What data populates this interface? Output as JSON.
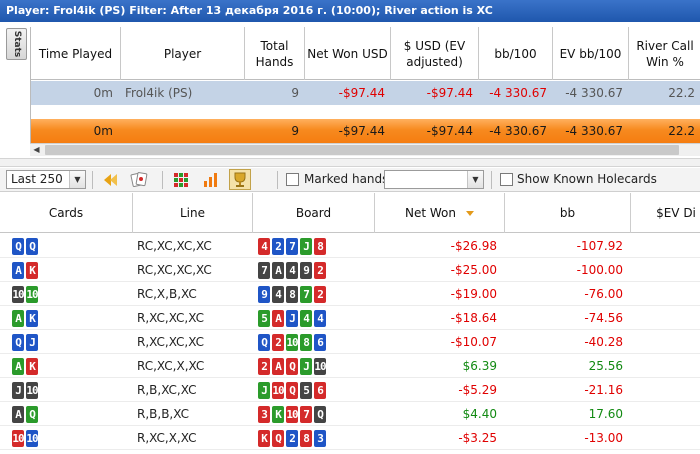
{
  "title_bar": "Player: Frol4ik (PS)   Filter: After 13 декабря 2016 г. (10:00); River action is XC",
  "side_tab": "Stats",
  "suit_colors": {
    "h": "#d42a2a",
    "d": "#1f55c6",
    "c": "#2b9b2b",
    "s": "#444444"
  },
  "stats": {
    "columns": [
      "Time Played",
      "Player",
      "Total Hands",
      "Net Won USD",
      "$ USD (EV adjusted)",
      "bb/100",
      "EV bb/100",
      "River Call Win %"
    ],
    "rows": [
      {
        "time": "0m",
        "player": "Frol4ik (PS)",
        "hands": "9",
        "net_won": "-$97.44",
        "usd_ev": "-$97.44",
        "bb100": "-4 330.67",
        "ev_bb100": "-4 330.67",
        "river_call": "22.2"
      },
      {
        "time": "0m",
        "player": "",
        "hands": "9",
        "net_won": "-$97.44",
        "usd_ev": "-$97.44",
        "bb100": "-4 330.67",
        "ev_bb100": "-4 330.67",
        "river_call": "22.2"
      }
    ]
  },
  "toolbar": {
    "range_select": "Last 250",
    "marked_hands_label": "Marked hands",
    "marked_hands_value": "",
    "show_holecards_label": "Show Known Holecards"
  },
  "hands": {
    "columns": [
      "Cards",
      "Line",
      "Board",
      "Net Won",
      "bb",
      "$EV Di"
    ],
    "rows": [
      {
        "cards": [
          {
            "r": "Q",
            "s": "d"
          },
          {
            "r": "Q",
            "s": "d"
          }
        ],
        "line": "RC,XC,XC,XC",
        "board": [
          {
            "r": "4",
            "s": "h"
          },
          {
            "r": "2",
            "s": "d"
          },
          {
            "r": "7",
            "s": "d"
          },
          {
            "r": "J",
            "s": "c"
          },
          {
            "r": "8",
            "s": "h"
          }
        ],
        "net_won": "-$26.98",
        "bb": "-107.92"
      },
      {
        "cards": [
          {
            "r": "A",
            "s": "d"
          },
          {
            "r": "K",
            "s": "h"
          }
        ],
        "line": "RC,XC,XC,XC",
        "board": [
          {
            "r": "7",
            "s": "s"
          },
          {
            "r": "A",
            "s": "s"
          },
          {
            "r": "4",
            "s": "s"
          },
          {
            "r": "9",
            "s": "s"
          },
          {
            "r": "2",
            "s": "h"
          }
        ],
        "net_won": "-$25.00",
        "bb": "-100.00"
      },
      {
        "cards": [
          {
            "r": "10",
            "s": "s"
          },
          {
            "r": "10",
            "s": "c"
          }
        ],
        "line": "RC,X,B,XC",
        "board": [
          {
            "r": "9",
            "s": "d"
          },
          {
            "r": "4",
            "s": "s"
          },
          {
            "r": "8",
            "s": "s"
          },
          {
            "r": "7",
            "s": "c"
          },
          {
            "r": "2",
            "s": "h"
          }
        ],
        "net_won": "-$19.00",
        "bb": "-76.00"
      },
      {
        "cards": [
          {
            "r": "A",
            "s": "c"
          },
          {
            "r": "K",
            "s": "d"
          }
        ],
        "line": "R,XC,XC,XC",
        "board": [
          {
            "r": "5",
            "s": "c"
          },
          {
            "r": "A",
            "s": "h"
          },
          {
            "r": "J",
            "s": "d"
          },
          {
            "r": "4",
            "s": "c"
          },
          {
            "r": "4",
            "s": "d"
          }
        ],
        "net_won": "-$18.64",
        "bb": "-74.56"
      },
      {
        "cards": [
          {
            "r": "Q",
            "s": "d"
          },
          {
            "r": "J",
            "s": "d"
          }
        ],
        "line": "R,XC,XC,XC",
        "board": [
          {
            "r": "Q",
            "s": "d"
          },
          {
            "r": "2",
            "s": "h"
          },
          {
            "r": "10",
            "s": "c"
          },
          {
            "r": "8",
            "s": "c"
          },
          {
            "r": "6",
            "s": "d"
          }
        ],
        "net_won": "-$10.07",
        "bb": "-40.28"
      },
      {
        "cards": [
          {
            "r": "A",
            "s": "c"
          },
          {
            "r": "K",
            "s": "h"
          }
        ],
        "line": "RC,XC,X,XC",
        "board": [
          {
            "r": "2",
            "s": "h"
          },
          {
            "r": "A",
            "s": "h"
          },
          {
            "r": "Q",
            "s": "h"
          },
          {
            "r": "J",
            "s": "c"
          },
          {
            "r": "10",
            "s": "s"
          }
        ],
        "net_won": "$6.39",
        "bb": "25.56"
      },
      {
        "cards": [
          {
            "r": "J",
            "s": "s"
          },
          {
            "r": "10",
            "s": "s"
          }
        ],
        "line": "R,B,XC,XC",
        "board": [
          {
            "r": "J",
            "s": "c"
          },
          {
            "r": "10",
            "s": "h"
          },
          {
            "r": "Q",
            "s": "h"
          },
          {
            "r": "5",
            "s": "s"
          },
          {
            "r": "6",
            "s": "h"
          }
        ],
        "net_won": "-$5.29",
        "bb": "-21.16"
      },
      {
        "cards": [
          {
            "r": "A",
            "s": "s"
          },
          {
            "r": "Q",
            "s": "c"
          }
        ],
        "line": "R,B,B,XC",
        "board": [
          {
            "r": "3",
            "s": "h"
          },
          {
            "r": "K",
            "s": "c"
          },
          {
            "r": "10",
            "s": "h"
          },
          {
            "r": "7",
            "s": "h"
          },
          {
            "r": "Q",
            "s": "s"
          }
        ],
        "net_won": "$4.40",
        "bb": "17.60"
      },
      {
        "cards": [
          {
            "r": "10",
            "s": "h"
          },
          {
            "r": "10",
            "s": "d"
          }
        ],
        "line": "R,XC,X,XC",
        "board": [
          {
            "r": "K",
            "s": "h"
          },
          {
            "r": "Q",
            "s": "h"
          },
          {
            "r": "2",
            "s": "d"
          },
          {
            "r": "8",
            "s": "h"
          },
          {
            "r": "3",
            "s": "d"
          }
        ],
        "net_won": "-$3.25",
        "bb": "-13.00"
      }
    ]
  }
}
